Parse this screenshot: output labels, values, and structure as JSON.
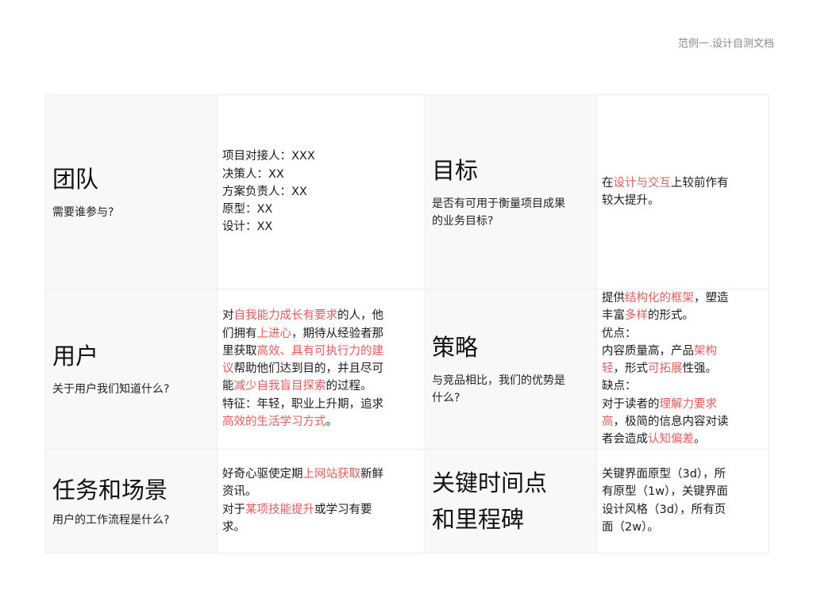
{
  "doc_label": "范例一.设计自测文档",
  "colors": {
    "highlight": "#e25c5c",
    "label_bg": "#f8f8f8",
    "border": "#ececec"
  },
  "rows": [
    {
      "left": {
        "title": "团队",
        "question": "需要谁参与?",
        "content": [
          [
            {
              "t": "项目对接人：XXX"
            }
          ],
          [
            {
              "t": "决策人：XX"
            }
          ],
          [
            {
              "t": "方案负责人：XX"
            }
          ],
          [
            {
              "t": "原型：XX"
            }
          ],
          [
            {
              "t": "设计：XX"
            }
          ]
        ]
      },
      "right": {
        "title": "目标",
        "question": "是否有可用于衡量项目成果的业务目标?",
        "content": [
          [
            {
              "t": "在"
            },
            {
              "t": "设计与交互",
              "hl": true
            },
            {
              "t": "上较前作有较大提升。"
            }
          ]
        ]
      }
    },
    {
      "left": {
        "title": "用户",
        "question": "关于用户我们知道什么?",
        "content": [
          [
            {
              "t": "对"
            },
            {
              "t": "自我能力成长有要求",
              "hl": true
            },
            {
              "t": "的人，他们拥有"
            },
            {
              "t": "上进心",
              "hl": true
            },
            {
              "t": "，期待从经验者那里获取"
            },
            {
              "t": "高效、具有可执行力的建议",
              "hl": true
            },
            {
              "t": "帮助他们达到目的，并且尽可能"
            },
            {
              "t": "减少自我盲目探索",
              "hl": true
            },
            {
              "t": "的过程。"
            }
          ],
          [
            {
              "t": "特征：年轻，职业上升期，追求"
            },
            {
              "t": "高效的生活学习方式",
              "hl": true
            },
            {
              "t": "。"
            }
          ]
        ]
      },
      "right": {
        "title": "策略",
        "question": "与竞品相比，我们的优势是什么?",
        "content": [
          [
            {
              "t": "提供"
            },
            {
              "t": "结构化的框架",
              "hl": true
            },
            {
              "t": "，塑造丰富"
            },
            {
              "t": "多样",
              "hl": true
            },
            {
              "t": "的形式。"
            }
          ],
          [
            {
              "t": "优点："
            }
          ],
          [
            {
              "t": "内容质量高，产品"
            },
            {
              "t": "架构轻",
              "hl": true
            },
            {
              "t": "，形式"
            },
            {
              "t": "可拓展",
              "hl": true
            },
            {
              "t": "性强。"
            }
          ],
          [
            {
              "t": "缺点："
            }
          ],
          [
            {
              "t": "对于读者的"
            },
            {
              "t": "理解力要求高",
              "hl": true
            },
            {
              "t": "，极简的信息内容对读者会造成"
            },
            {
              "t": "认知偏差",
              "hl": true
            },
            {
              "t": "。"
            }
          ]
        ]
      }
    },
    {
      "left": {
        "title": "任务和场景",
        "question": "用户的工作流程是什么?",
        "content": [
          [
            {
              "t": "好奇心驱使定期"
            },
            {
              "t": "上网站获取",
              "hl": true
            },
            {
              "t": "新鲜资讯。"
            }
          ],
          [
            {
              "t": "对于"
            },
            {
              "t": "某项技能提升",
              "hl": true
            },
            {
              "t": "或学习有要求。"
            }
          ]
        ]
      },
      "right": {
        "title": "关键时间点和里程碑",
        "question": "",
        "content": [
          [
            {
              "t": "关键界面原型（3d），所有原型（1w），关键界面设计风格（3d），所有页面（2w）。"
            }
          ]
        ]
      }
    }
  ]
}
